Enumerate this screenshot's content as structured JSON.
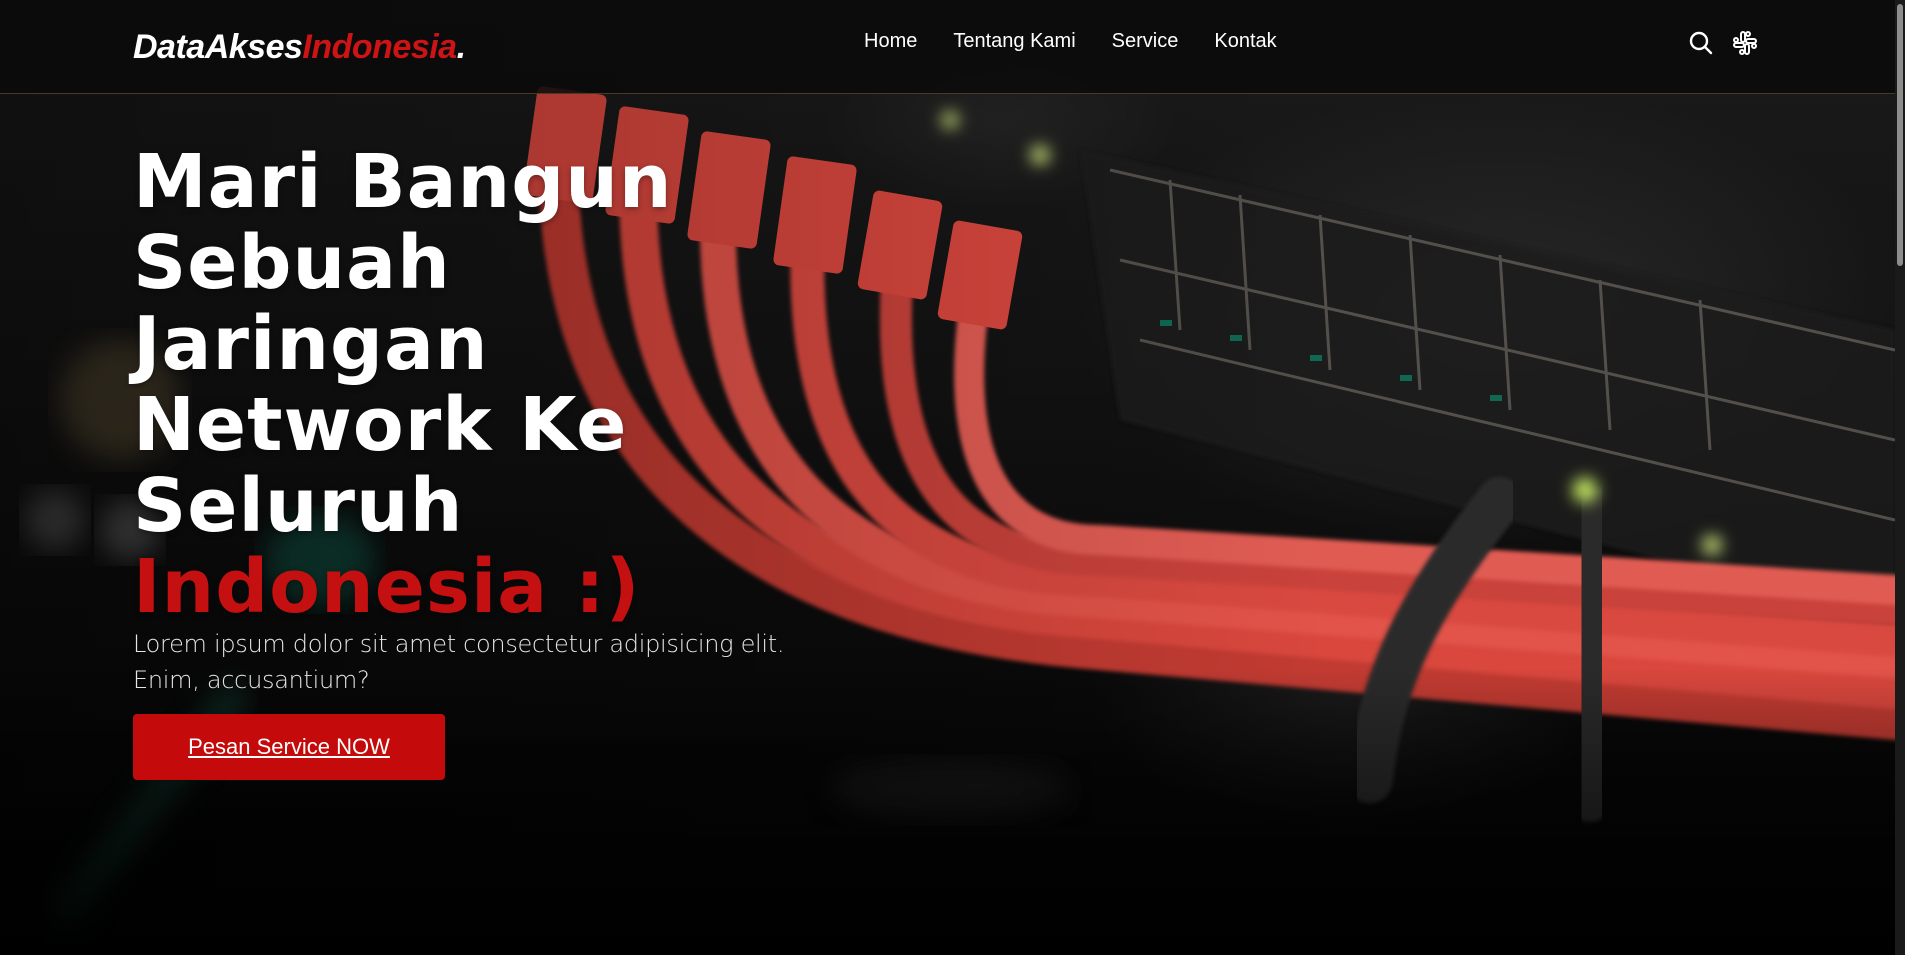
{
  "navbar": {
    "logo_part1": "DataAkses",
    "logo_part2": "Indonesia",
    "logo_part3": ".",
    "links": [
      "Home",
      "Tentang Kami",
      "Service",
      "Kontak"
    ],
    "icons": [
      "search-icon",
      "slack-icon"
    ]
  },
  "hero": {
    "title_lines": [
      "Mari Bangun",
      "Sebuah",
      "Jaringan",
      "Network Ke",
      "Seluruh"
    ],
    "title_accent": "Indonesia :)",
    "subtitle": "Lorem ipsum dolor sit amet consectetur adipisicing elit. Enim, accusantium?",
    "cta_label": "Pesan Service NOW"
  },
  "colors": {
    "accent": "#c40a0a",
    "background": "#050505",
    "text": "#ffffff"
  }
}
